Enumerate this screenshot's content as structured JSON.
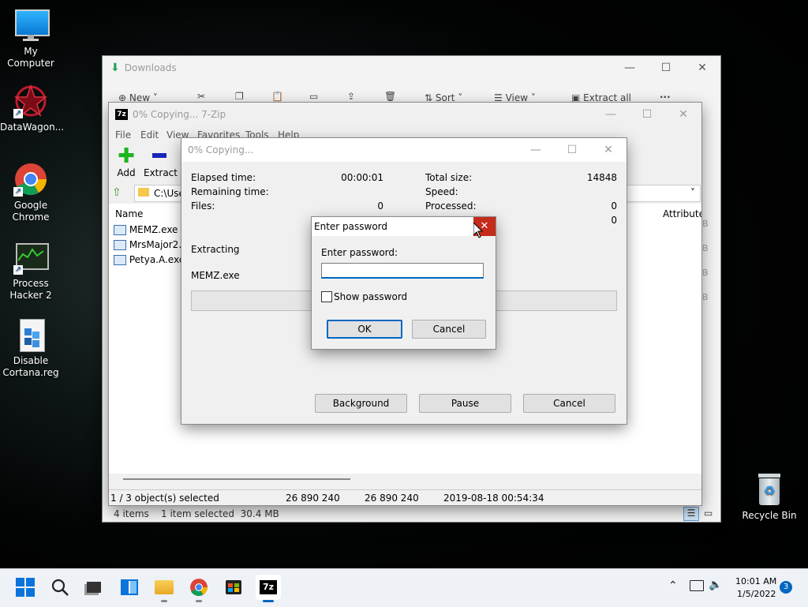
{
  "desktop": {
    "icons": [
      {
        "label": "My Computer",
        "icon": "monitor-icon"
      },
      {
        "label": "DataWagon...",
        "icon": "datawagon-icon"
      },
      {
        "label": "Google Chrome",
        "icon": "chrome-icon"
      },
      {
        "label": "Process Hacker 2",
        "icon": "process-hacker-icon"
      },
      {
        "label": "Disable Cortana.reg",
        "icon": "registry-icon"
      },
      {
        "label": "Recycle Bin",
        "icon": "recycle-bin-icon"
      }
    ]
  },
  "explorer": {
    "title": "Downloads",
    "toolbar": {
      "new": "New",
      "sort": "Sort",
      "view": "View",
      "extract_all": "Extract all",
      "more": "..."
    },
    "status": {
      "items": "4 items",
      "selected": "1 item selected  30.4 MB"
    }
  },
  "sevenzip": {
    "title": "0% Copying... 7-Zip",
    "menu": [
      "File",
      "Edit",
      "View",
      "Favorites",
      "Tools",
      "Help"
    ],
    "toolbar": {
      "add": "Add",
      "extract": "Extract"
    },
    "path": "C:\\Use",
    "columns": {
      "name": "Name",
      "attributes": "Attribute"
    },
    "files": [
      {
        "name": "MEMZ.exe"
      },
      {
        "name": "MrsMajor2.0."
      },
      {
        "name": "Petya.A.exe"
      }
    ],
    "size_col_fragments": [
      "B",
      "B",
      "B",
      "B"
    ],
    "status": {
      "selection": "1 / 3 object(s) selected",
      "size": "26 890 240",
      "packed": "26 890 240",
      "modified": "2019-08-18 00:54:34"
    }
  },
  "copying": {
    "title": "0% Copying...",
    "left": [
      {
        "label": "Elapsed time:",
        "value": "00:00:01"
      },
      {
        "label": "Remaining time:",
        "value": ""
      },
      {
        "label": "Files:",
        "value": "0"
      }
    ],
    "right": [
      {
        "label": "Total size:",
        "value": "14848"
      },
      {
        "label": "Speed:",
        "value": ""
      },
      {
        "label": "Processed:",
        "value": "0"
      },
      {
        "label": "",
        "value": "0"
      }
    ],
    "status_text": "Extracting",
    "current_file": "MEMZ.exe",
    "progress": 0,
    "buttons": {
      "background": "Background",
      "pause": "Pause",
      "cancel": "Cancel"
    }
  },
  "password_dialog": {
    "title": "Enter password",
    "prompt": "Enter password:",
    "value": "",
    "show_password": "Show password",
    "ok": "OK",
    "cancel": "Cancel"
  },
  "taskbar": {
    "time": "10:01 AM",
    "date": "1/5/2022",
    "notifications": "3"
  }
}
